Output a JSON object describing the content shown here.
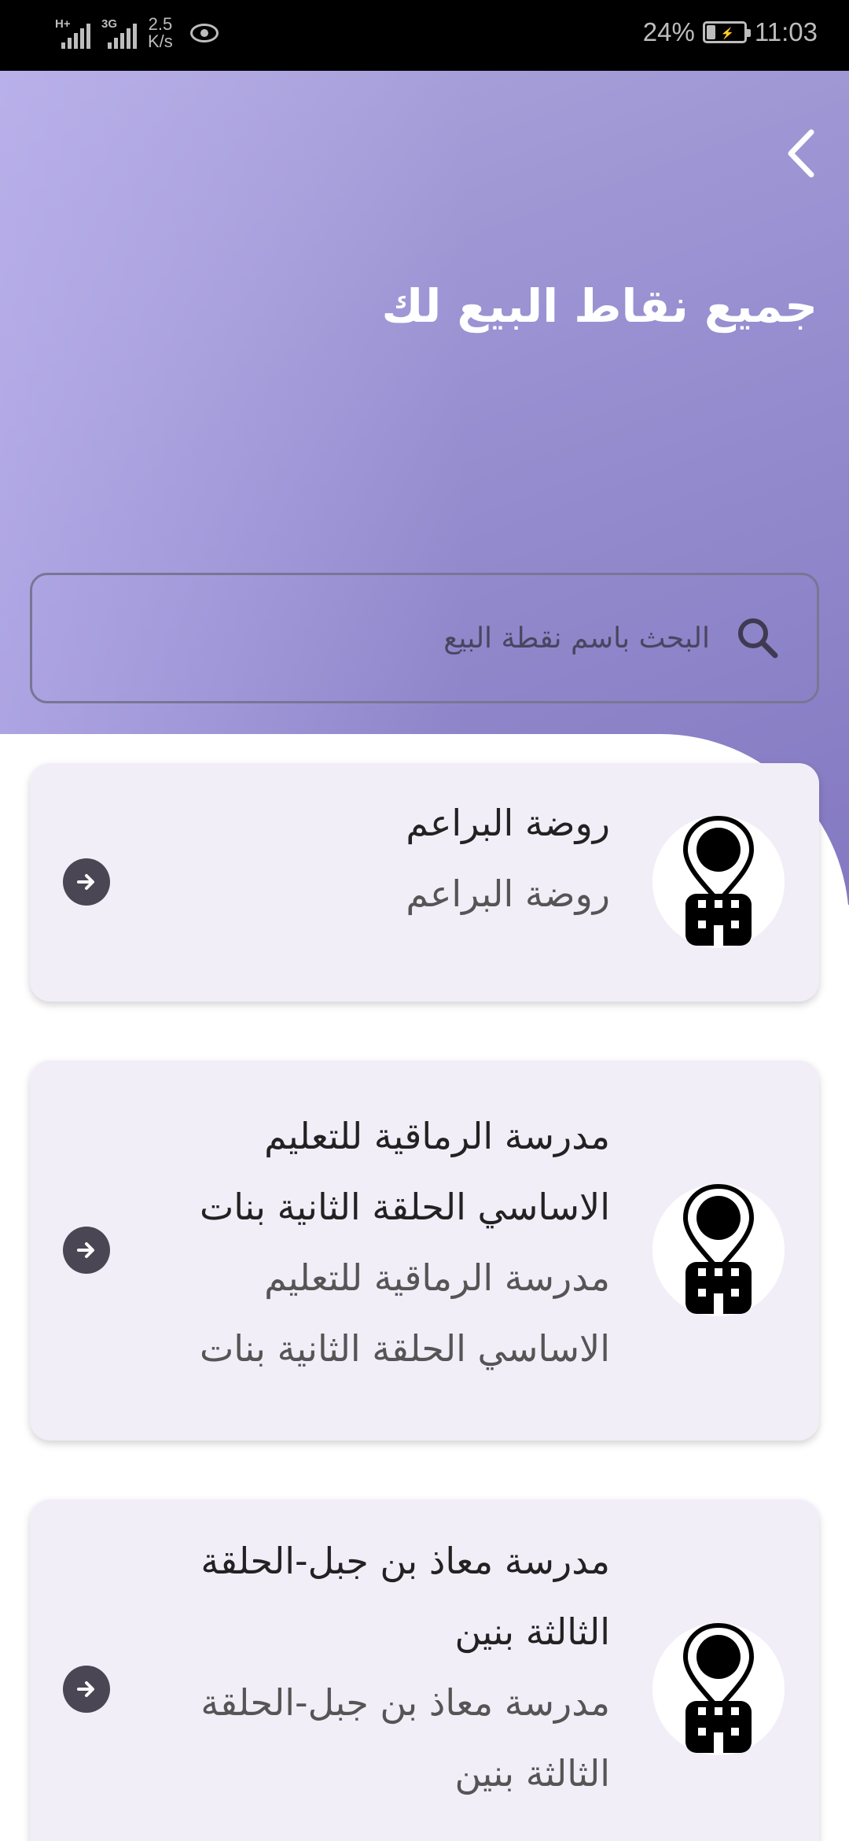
{
  "status_bar": {
    "network_1": "H+",
    "network_2": "3G",
    "speed_value": "2.5",
    "speed_unit": "K/s",
    "battery_percent": "24%",
    "battery_level": 0.24,
    "time": "11:03"
  },
  "header": {
    "title": "جميع نقاط البيع لك",
    "back_icon": "chevron-right-icon",
    "gradient_colors": [
      "#ada5dc",
      "#978fd0",
      "#8479c2"
    ]
  },
  "search": {
    "placeholder": "البحث باسم نقطة البيع",
    "value": "",
    "icon": "search-icon"
  },
  "points": [
    {
      "title": "روضة البراعم",
      "subtitle": "روضة البراعم"
    },
    {
      "title": "مدرسة الرماقية للتعليم الاساسي الحلقة الثانية بنات",
      "subtitle": "مدرسة الرماقية للتعليم الاساسي الحلقة الثانية بنات"
    },
    {
      "title": "مدرسة معاذ بن جبل-الحلقة الثالثة بنين",
      "subtitle": "مدرسة معاذ بن جبل-الحلقة الثالثة بنين"
    }
  ],
  "colors": {
    "card_bg": "#f2eef8",
    "go_button": "#4a4653"
  }
}
